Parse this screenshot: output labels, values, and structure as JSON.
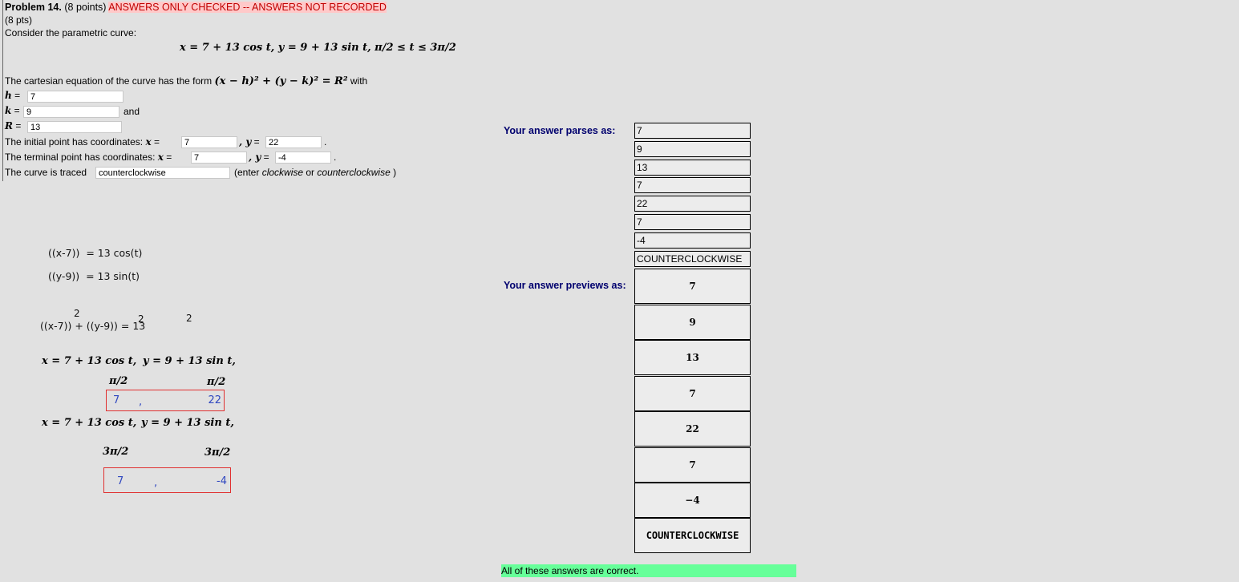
{
  "header": {
    "problem": "Problem 14.",
    "points": "(8 points)",
    "warning": "ANSWERS ONLY CHECKED -- ANSWERS NOT RECORDED",
    "pts": "(8 pts)",
    "intro": "Consider the parametric curve:",
    "curve": "x = 7 + 13 cos t,    y = 9 + 13 sin t,    π/2 ≤ t ≤ 3π/2"
  },
  "question": {
    "cartesian_text": "The cartesian equation of the curve has the form",
    "cartesian_formula": "(x − h)² + (y − k)² = R²",
    "with": "with",
    "h_label": "h",
    "k_label": "k",
    "R_label": "R",
    "eq": "=",
    "and": "and",
    "initial_text": "The initial point has coordinates:",
    "terminal_text": "The terminal point has coordinates:",
    "x_label": "x",
    "y_label": ", y",
    "dot": ".",
    "traced_text": "The curve is traced",
    "traced_hint_pre": "(enter ",
    "traced_hint_cw": "clockwise",
    "traced_hint_or": " or ",
    "traced_hint_ccw": "counterclockwise",
    "traced_hint_post": " )"
  },
  "answers": {
    "h": "7",
    "k": "9",
    "R": "13",
    "initial_x": "7",
    "initial_y": "22",
    "terminal_x": "7",
    "terminal_y": "-4",
    "direction": "counterclockwise"
  },
  "feedback": {
    "parses_label": "Your answer parses as:",
    "previews_label": "Your answer previews as:",
    "parsed": [
      "7",
      "9",
      "13",
      "7",
      "22",
      "7",
      "-4",
      "COUNTERCLOCKWISE"
    ],
    "previews": [
      "7",
      "9",
      "13",
      "7",
      "22",
      "7",
      "−4",
      "COUNTERCLOCKWISE"
    ],
    "result": "All of these answers are correct."
  },
  "work": {
    "line1_lhs": "((x-7))",
    "line1_rhs": "=  13 cos(t)",
    "line2_lhs": "((y-9))",
    "line2_rhs": "=  13 sin(t)",
    "sq_eq": "((x-7))  +  ((y-9))   =  13",
    "sup": "2",
    "curve_x": "x = 7 + 13 cos t,",
    "curve_y": "y = 9 + 13 sin t,",
    "t1": "π/2",
    "t2": "3π/2",
    "box1_x": "7",
    "box1_y": "22",
    "box2_x": "7",
    "box2_y": "-4",
    "comma": ","
  }
}
